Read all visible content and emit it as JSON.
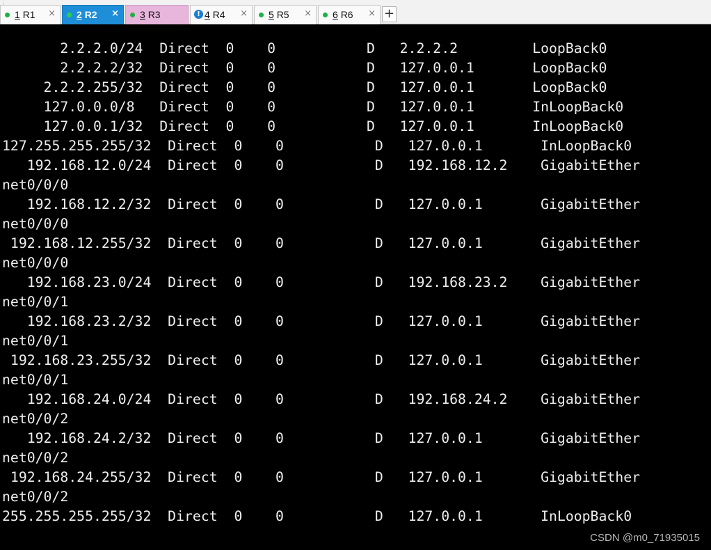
{
  "tabs": [
    {
      "number": "1",
      "name": "R1",
      "status": "connected",
      "state": "normal",
      "close": "×"
    },
    {
      "number": "2",
      "name": "R2",
      "status": "connected",
      "state": "active",
      "close": "×"
    },
    {
      "number": "3",
      "name": "R3",
      "status": "connected",
      "state": "highlighted",
      "close": ""
    },
    {
      "number": "4",
      "name": "R4",
      "status": "alert",
      "state": "normal",
      "close": "×"
    },
    {
      "number": "5",
      "name": "R5",
      "status": "connected",
      "state": "normal",
      "close": "×"
    },
    {
      "number": "6",
      "name": "R6",
      "status": "connected",
      "state": "normal",
      "close": "×"
    }
  ],
  "new_tab_label": "+",
  "tab_alert_glyph": "!",
  "colors": {
    "active_tab": "#1f8ed8",
    "highlighted_tab": "#e8b6dc",
    "connected_dot": "#1fb141",
    "alert_icon": "#1e7fd0",
    "terminal_bg": "#000000",
    "terminal_fg": "#ededed"
  },
  "terminal_lines": [
    "",
    "       2.2.2.0/24  Direct  0    0           D   2.2.2.2         LoopBack0",
    "       2.2.2.2/32  Direct  0    0           D   127.0.0.1       LoopBack0",
    "     2.2.2.255/32  Direct  0    0           D   127.0.0.1       LoopBack0",
    "     127.0.0.0/8   Direct  0    0           D   127.0.0.1       InLoopBack0",
    "     127.0.0.1/32  Direct  0    0           D   127.0.0.1       InLoopBack0",
    "127.255.255.255/32  Direct  0    0           D   127.0.0.1       InLoopBack0",
    "   192.168.12.0/24  Direct  0    0           D   192.168.12.2    GigabitEther",
    "net0/0/0",
    "   192.168.12.2/32  Direct  0    0           D   127.0.0.1       GigabitEther",
    "net0/0/0",
    " 192.168.12.255/32  Direct  0    0           D   127.0.0.1       GigabitEther",
    "net0/0/0",
    "   192.168.23.0/24  Direct  0    0           D   192.168.23.2    GigabitEther",
    "net0/0/1",
    "   192.168.23.2/32  Direct  0    0           D   127.0.0.1       GigabitEther",
    "net0/0/1",
    " 192.168.23.255/32  Direct  0    0           D   127.0.0.1       GigabitEther",
    "net0/0/1",
    "   192.168.24.0/24  Direct  0    0           D   192.168.24.2    GigabitEther",
    "net0/0/2",
    "   192.168.24.2/32  Direct  0    0           D   127.0.0.1       GigabitEther",
    "net0/0/2",
    " 192.168.24.255/32  Direct  0    0           D   127.0.0.1       GigabitEther",
    "net0/0/2",
    "255.255.255.255/32  Direct  0    0           D   127.0.0.1       InLoopBack0"
  ],
  "watermark": "CSDN @m0_71935015"
}
